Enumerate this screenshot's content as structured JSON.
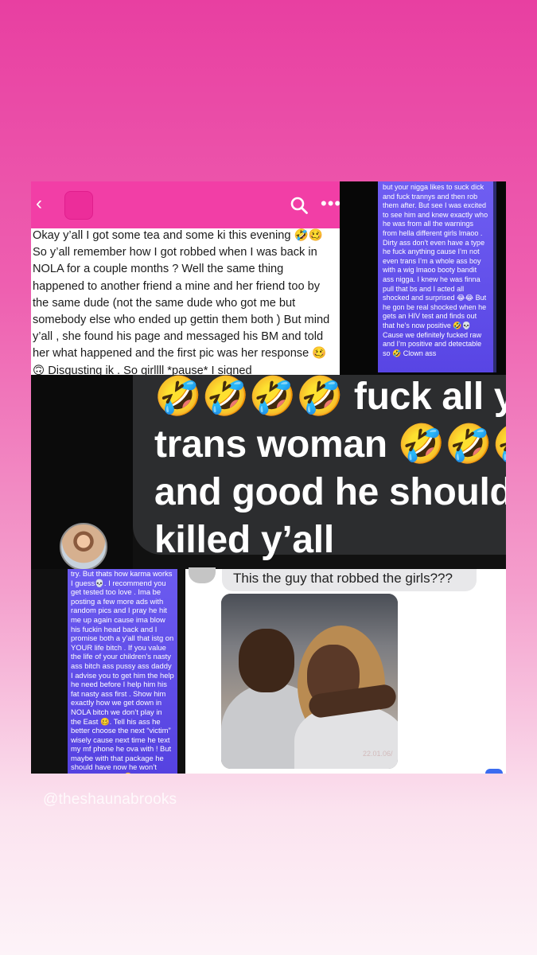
{
  "post": {
    "text": "Okay y’all I got some tea and some ki this evening 🤣🥴 So y’all remember how I got robbed when I was back in NOLA for a couple months ? Well the same thing happened to another friend a mine and her friend too by the same dude (not the same dude who got me but somebody else who ended up gettin them both ) But mind y’all , she found his page and messaged his BM and told her what happened and the first pic was her response 🥴🙃 Disgusting ik . So girllll *pause* I signed",
    "icons": {
      "back": "‹",
      "more": "•••"
    },
    "colors": {
      "app_bar": "#f23ea6"
    }
  },
  "top_right_message": "but your nigga likes to suck dick and fuck trannys and then rob them after. But see I was excited to see him and knew exactly who he was from all the warnings from hella different girls lmaoo . Dirty ass don’t even have a type he fuck anything cause I’m not even trans I’m a whole ass boy with a wig lmaoo booty bandit ass nigga. I knew he was finna pull that bs and I acted all shocked and surprised 😂😂 But he gon be real shocked when he gets an HIV test and finds out that he’s now positive 🤣💀 Cause we definitely fucked raw and I’m positive and detectable so 🤣 Clown ass",
  "tweet": {
    "line1": "🤣🤣🤣🤣 fuck all y",
    "line2": "trans woman 🤣🤣🤣",
    "line3": "and good he should",
    "line4": "killed y’all"
  },
  "bottom_left_message": "try. But thats how karma works I guess💀. I recommend you get tested too love . Ima be posting a few more ads with random pics and I pray he hit me up again cause ima blow his fuckin head back and I promise both a y’all that istg on YOUR life bitch . If you value the life of your children’s nasty ass bitch ass pussy ass daddy I advise you to get him the help he need before I help him his fat nasty ass first . Show him exactly how we get down in NOLA bitch we don’t play in the East 🥴. Tell his ass he better choose the next “victim” wisely cause next time he text my mf phone he ova with ! But maybe with that package he should have now he won’t bother no more 🤣",
  "chat": {
    "message": "This the guy that robbed the girls???",
    "photo_stamp": "22.01.06/"
  },
  "watermark": "@theshaunabrooks"
}
